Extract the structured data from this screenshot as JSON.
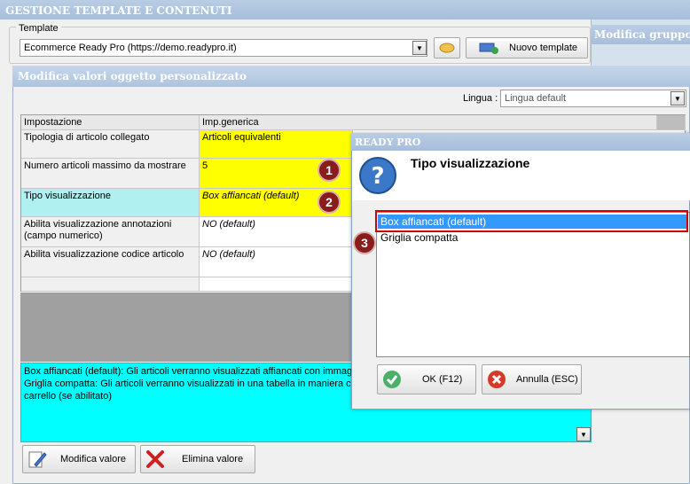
{
  "main_window": {
    "title": "GESTIONE TEMPLATE E CONTENUTI"
  },
  "template": {
    "group_label": "Template",
    "selected": "Ecommerce Ready Pro (https://demo.readypro.it)",
    "new_template_label": "Nuovo template"
  },
  "right_panel": {
    "title": "Modifica gruppo"
  },
  "editor": {
    "title": "Modifica valori oggetto personalizzato",
    "language_label": "Lingua :",
    "language_value": "Lingua default",
    "grid": {
      "headers": [
        "Impostazione",
        "Imp.generica"
      ],
      "rows": [
        {
          "setting": "Tipologia di articolo collegato",
          "value": "Articoli equivalenti"
        },
        {
          "setting": "Numero articoli massimo da mostrare",
          "value": "5"
        },
        {
          "setting": "Tipo visualizzazione",
          "value": "Box affiancati (default)"
        },
        {
          "setting": "Abilita visualizzazione annotazioni (campo numerico)",
          "value": "NO (default)"
        },
        {
          "setting": "Abilita visualizzazione codice articolo",
          "value": "NO (default)"
        }
      ]
    },
    "description_line1": "Box affiancati (default): Gli articoli verranno visualizzati affiancati con immagin",
    "description_line2": "Griglia compatta: Gli articoli verranno visualizzati in una tabella in maniera com",
    "description_line3": "carrello (se abilitato)",
    "edit_value_label": "Modifica valore",
    "delete_value_label": "Elimina valore"
  },
  "dialog": {
    "window_title": "READY PRO",
    "heading": "Tipo visualizzazione",
    "options": [
      "Box affiancati (default)",
      "Griglia compatta"
    ],
    "ok_label": "OK (F12)",
    "cancel_label": "Annulla (ESC)"
  },
  "badges": [
    "1",
    "2",
    "3"
  ],
  "colors": {
    "highlight_yellow": "#ffff00",
    "selected_row_cyan": "#b0f0f0",
    "description_bg": "#00ffff",
    "list_selection": "#3399ff",
    "callout_red": "#d00000",
    "badge": "#8a1c1c"
  }
}
